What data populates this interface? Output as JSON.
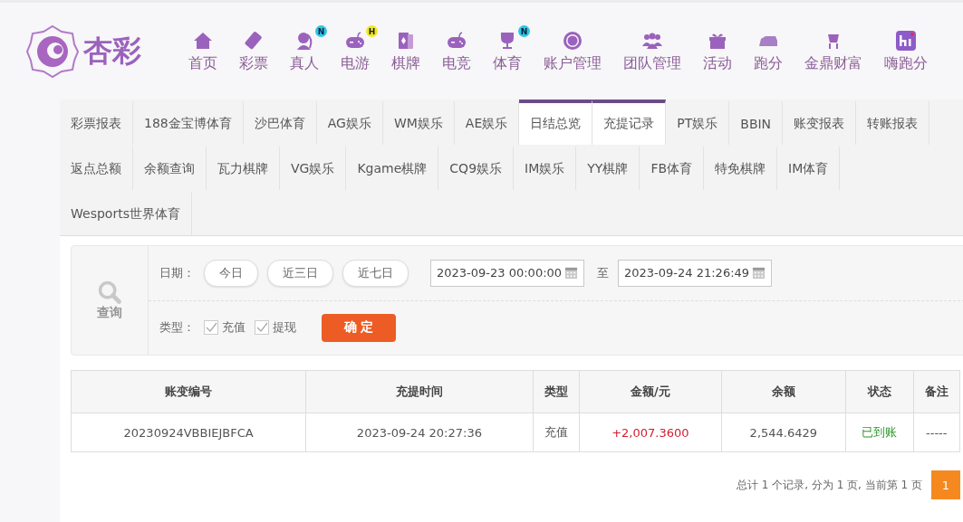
{
  "logo": {
    "text": "杏彩"
  },
  "nav": [
    {
      "label": "首页"
    },
    {
      "label": "彩票"
    },
    {
      "label": "真人",
      "badge": "N",
      "color": "#2ec4e8"
    },
    {
      "label": "电游",
      "badge": "H",
      "color": "#f3e81c"
    },
    {
      "label": "棋牌"
    },
    {
      "label": "电竞"
    },
    {
      "label": "体育",
      "badge": "N",
      "color": "#2ec4e8"
    },
    {
      "label": "账户管理"
    },
    {
      "label": "团队管理"
    },
    {
      "label": "活动"
    },
    {
      "label": "跑分"
    },
    {
      "label": "金鼎财富"
    },
    {
      "label": "嗨跑分"
    }
  ],
  "tabs": [
    {
      "label": "彩票报表",
      "selected": false
    },
    {
      "label": "188金宝博体育",
      "selected": false
    },
    {
      "label": "沙巴体育",
      "selected": false
    },
    {
      "label": "AG娱乐",
      "selected": false
    },
    {
      "label": "WM娱乐",
      "selected": false
    },
    {
      "label": "AE娱乐",
      "selected": false
    },
    {
      "label": "日结总览",
      "selected": true
    },
    {
      "label": "充提记录",
      "selected": true
    },
    {
      "label": "PT娱乐",
      "selected": false
    },
    {
      "label": "BBIN",
      "selected": false
    },
    {
      "label": "账变报表",
      "selected": false
    },
    {
      "label": "转账报表",
      "selected": false
    },
    {
      "label": "返点总额",
      "selected": false
    },
    {
      "label": "余额查询",
      "selected": false
    },
    {
      "label": "瓦力棋牌",
      "selected": false
    },
    {
      "label": "VG娱乐",
      "selected": false
    },
    {
      "label": "Kgame棋牌",
      "selected": false
    },
    {
      "label": "CQ9娱乐",
      "selected": false
    },
    {
      "label": "IM娱乐",
      "selected": false
    },
    {
      "label": "YY棋牌",
      "selected": false
    },
    {
      "label": "FB体育",
      "selected": false
    },
    {
      "label": "特免棋牌",
      "selected": false
    },
    {
      "label": "IM体育",
      "selected": false
    },
    {
      "label": "Wesports世界体育",
      "selected": false
    }
  ],
  "filter": {
    "search_label": "查询",
    "date_label": "日期：",
    "quick_ranges": [
      "今日",
      "近三日",
      "近七日"
    ],
    "start": "2023-09-23 00:00:00",
    "to": "至",
    "end": "2023-09-24 21:26:49",
    "type_label": "类型：",
    "types": [
      {
        "label": "充值",
        "checked": true
      },
      {
        "label": "提现",
        "checked": true
      }
    ],
    "confirm": "确 定"
  },
  "table": {
    "columns": [
      {
        "label": "账变编号",
        "kind": "text"
      },
      {
        "label": "充提时间",
        "kind": "text"
      },
      {
        "label": "类型",
        "kind": "text"
      },
      {
        "label": "金额/元",
        "kind": "amount"
      },
      {
        "label": "余额",
        "kind": "text"
      },
      {
        "label": "状态",
        "kind": "status"
      },
      {
        "label": "备注",
        "kind": "text"
      }
    ],
    "rows": [
      [
        "20230924VBBIEJBFCA",
        "2023-09-24 20:27:36",
        "充值",
        "+2,007.3600",
        "2,544.6429",
        "已到账",
        "-----"
      ]
    ]
  },
  "pagination": {
    "summary": "总计 1 个记录, 分为 1 页, 当前第 1 页",
    "pages": [
      {
        "label": "1",
        "selected": true
      }
    ]
  }
}
